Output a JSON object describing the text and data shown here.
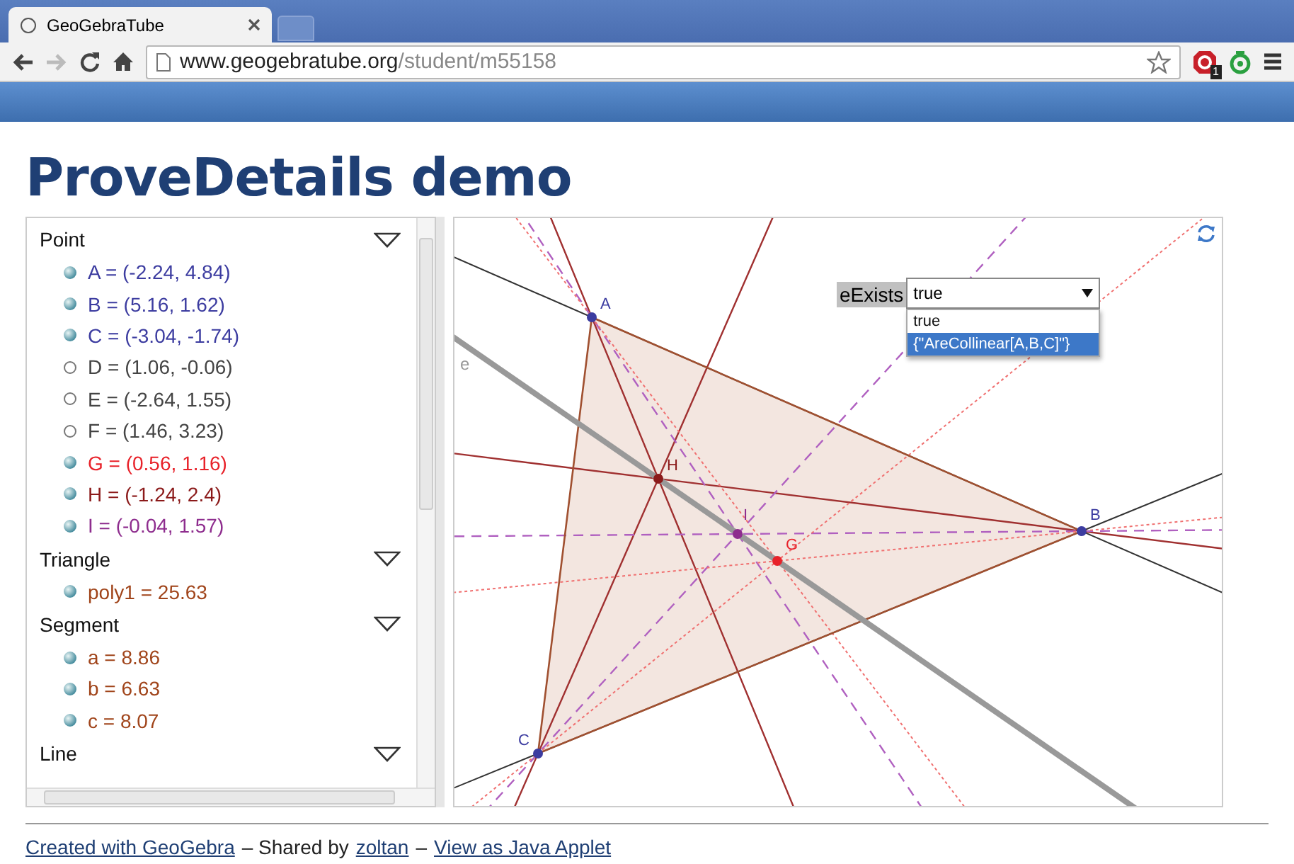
{
  "browser": {
    "tab_title": "GeoGebraTube",
    "url_host": "www.geogebratube.org",
    "url_path": "/student/m55158",
    "extension_badge": "1"
  },
  "page_title": "ProveDetails demo",
  "algebra": {
    "groups": [
      {
        "title": "Point",
        "items": [
          {
            "text": "A = (-2.24, 4.84)",
            "color": "#3c3ca0",
            "visible": true
          },
          {
            "text": "B = (5.16, 1.62)",
            "color": "#3c3ca0",
            "visible": true
          },
          {
            "text": "C = (-3.04, -1.74)",
            "color": "#3c3ca0",
            "visible": true
          },
          {
            "text": "D = (1.06, -0.06)",
            "color": "#444444",
            "visible": false
          },
          {
            "text": "E = (-2.64, 1.55)",
            "color": "#444444",
            "visible": false
          },
          {
            "text": "F = (1.46, 3.23)",
            "color": "#444444",
            "visible": false
          },
          {
            "text": "G = (0.56, 1.16)",
            "color": "#e8222a",
            "visible": true
          },
          {
            "text": "H = (-1.24, 2.4)",
            "color": "#8b1a1a",
            "visible": true
          },
          {
            "text": "I = (-0.04, 1.57)",
            "color": "#8e2d8e",
            "visible": true
          }
        ]
      },
      {
        "title": "Triangle",
        "items": [
          {
            "text": "poly1 = 25.63",
            "color": "#a0441a",
            "visible": true
          }
        ]
      },
      {
        "title": "Segment",
        "items": [
          {
            "text": "a = 8.86",
            "color": "#a0441a",
            "visible": true
          },
          {
            "text": "b = 6.63",
            "color": "#a0441a",
            "visible": true
          },
          {
            "text": "c = 8.07",
            "color": "#a0441a",
            "visible": true
          }
        ]
      },
      {
        "title": "Line"
      }
    ]
  },
  "canvas": {
    "line_label": "e",
    "points": [
      {
        "label": "A",
        "color": "#3c3ca0"
      },
      {
        "label": "B",
        "color": "#3c3ca0"
      },
      {
        "label": "C",
        "color": "#3c3ca0"
      },
      {
        "label": "H",
        "color": "#8b1a1a"
      },
      {
        "label": "I",
        "color": "#8e2d8e"
      },
      {
        "label": "G",
        "color": "#e8222a"
      }
    ],
    "dropdown": {
      "label": "eExists",
      "value": "true",
      "expanded": true,
      "options": [
        {
          "text": "true",
          "highlighted": false
        },
        {
          "text": "{\"AreCollinear[A,B,C]\"}",
          "highlighted": true
        }
      ]
    }
  },
  "footer": [
    {
      "kind": "link",
      "text": "Created with GeoGebra"
    },
    {
      "kind": "text",
      "text": "– Shared by"
    },
    {
      "kind": "link",
      "text": "zoltan"
    },
    {
      "kind": "text",
      "text": "–"
    },
    {
      "kind": "link",
      "text": "View as Java Applet"
    }
  ]
}
